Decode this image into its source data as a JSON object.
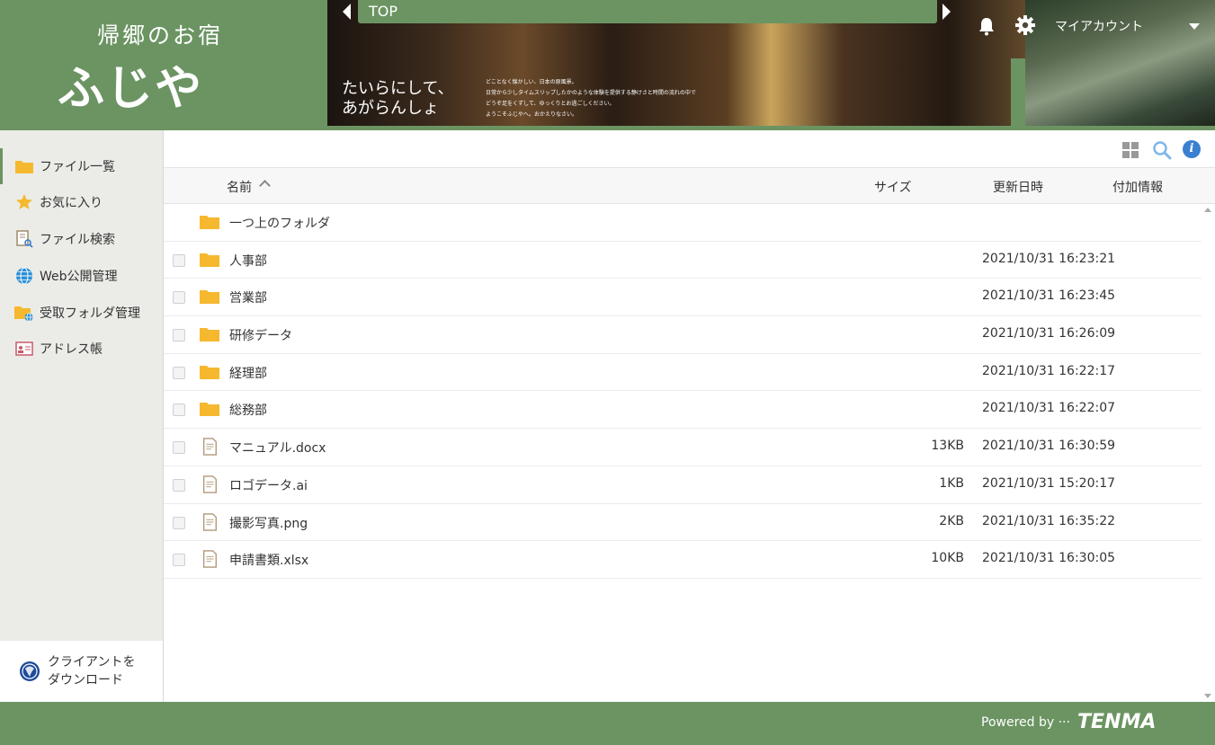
{
  "header": {
    "logo_sub": "帰郷のお宿",
    "logo_main": "ふじや",
    "banner_tagline_line1": "たいらにして、",
    "banner_tagline_line2": "あがらんしょ",
    "banner_small_line1": "どことなく懐かしい、日本の原風景。",
    "banner_small_line2": "日常から少しタイムスリップしたかのような体験を提供する静けさと時間の流れの中で",
    "banner_small_line3": "どうぞ足をくずして、ゆっくりとお過ごしください。",
    "banner_small_line4": "ようこそふじやへ。おかえりなさい。",
    "nav_label": "TOP",
    "account_label": "マイアカウント",
    "icons": [
      "bell-icon",
      "gear-icon",
      "chevron-down-icon"
    ]
  },
  "sidebar": {
    "items": [
      {
        "label": "ファイル一覧",
        "icon": "folder-icon",
        "active": true
      },
      {
        "label": "お気に入り",
        "icon": "star-icon",
        "active": false
      },
      {
        "label": "ファイル検索",
        "icon": "file-search-icon",
        "active": false
      },
      {
        "label": "Web公開管理",
        "icon": "globe-icon",
        "active": false
      },
      {
        "label": "受取フォルダ管理",
        "icon": "folder-globe-icon",
        "active": false
      },
      {
        "label": "アドレス帳",
        "icon": "address-card-icon",
        "active": false
      }
    ],
    "download_line1": "クライアントを",
    "download_line2": "ダウンロード"
  },
  "toolbar": {
    "icons": [
      "grid-view-icon",
      "search-icon",
      "info-icon"
    ],
    "info_glyph": "i"
  },
  "table": {
    "columns": {
      "name": "名前",
      "size": "サイズ",
      "modified": "更新日時",
      "extra": "付加情報"
    },
    "parent_folder": "一つ上のフォルダ",
    "rows": [
      {
        "type": "folder",
        "name": "人事部",
        "size": "",
        "modified": "2021/10/31 16:23:21"
      },
      {
        "type": "folder",
        "name": "営業部",
        "size": "",
        "modified": "2021/10/31 16:23:45"
      },
      {
        "type": "folder",
        "name": "研修データ",
        "size": "",
        "modified": "2021/10/31 16:26:09"
      },
      {
        "type": "folder",
        "name": "経理部",
        "size": "",
        "modified": "2021/10/31 16:22:17"
      },
      {
        "type": "folder",
        "name": "総務部",
        "size": "",
        "modified": "2021/10/31 16:22:07"
      },
      {
        "type": "file",
        "name": "マニュアル.docx",
        "size": "13KB",
        "modified": "2021/10/31 16:30:59"
      },
      {
        "type": "file",
        "name": "ロゴデータ.ai",
        "size": "1KB",
        "modified": "2021/10/31 15:20:17"
      },
      {
        "type": "file",
        "name": "撮影写真.png",
        "size": "2KB",
        "modified": "2021/10/31 16:35:22"
      },
      {
        "type": "file",
        "name": "申請書類.xlsx",
        "size": "10KB",
        "modified": "2021/10/31 16:30:05"
      }
    ]
  },
  "footer": {
    "powered_by": "Powered by ···",
    "brand": "TENMA"
  },
  "colors": {
    "brand_green": "#6b9462",
    "folder_yellow": "#f5b82e",
    "info_blue": "#3a7fd0"
  }
}
